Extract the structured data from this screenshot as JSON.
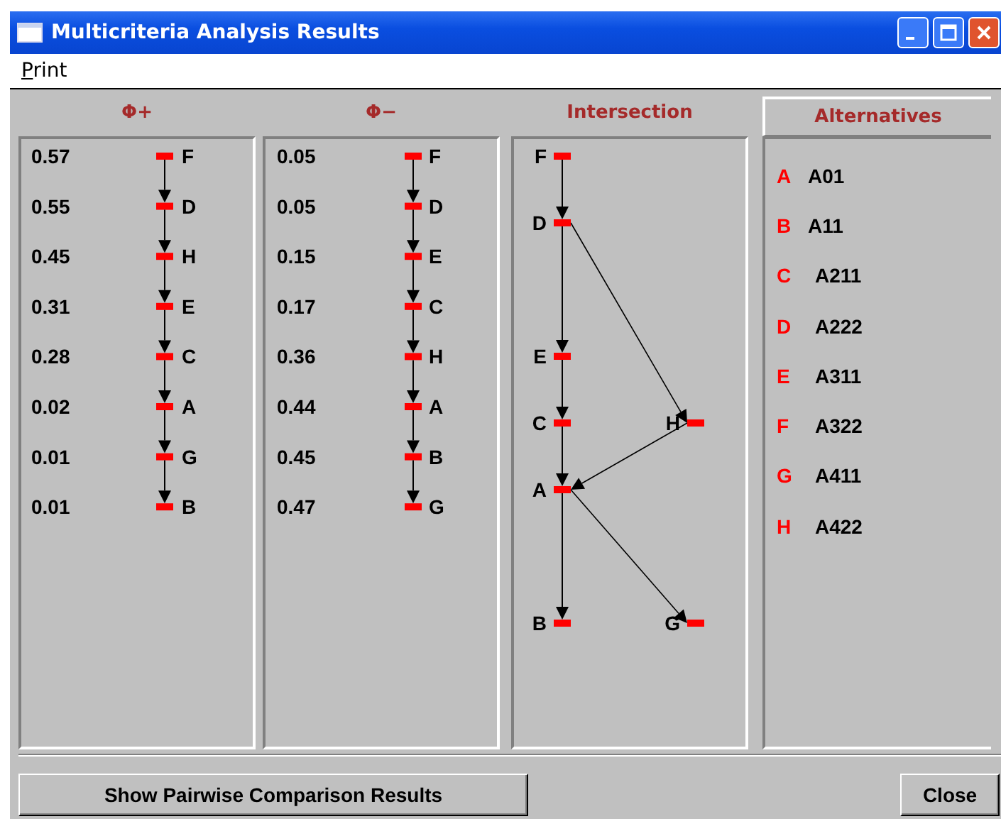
{
  "window": {
    "title": "Multicriteria Analysis Results"
  },
  "menu": [
    "Print"
  ],
  "rankings": [
    {
      "title": "Φ+",
      "rows": [
        {
          "value": "0.57",
          "node": "F"
        },
        {
          "value": "0.55",
          "node": "D"
        },
        {
          "value": "0.45",
          "node": "H"
        },
        {
          "value": "0.31",
          "node": "E"
        },
        {
          "value": "0.28",
          "node": "C"
        },
        {
          "value": "0.02",
          "node": "A"
        },
        {
          "value": "0.01",
          "node": "G"
        },
        {
          "value": "0.01",
          "node": "B"
        }
      ]
    },
    {
      "title": "Φ−",
      "rows": [
        {
          "value": "0.05",
          "node": "F"
        },
        {
          "value": "0.05",
          "node": "D"
        },
        {
          "value": "0.15",
          "node": "E"
        },
        {
          "value": "0.17",
          "node": "C"
        },
        {
          "value": "0.36",
          "node": "H"
        },
        {
          "value": "0.44",
          "node": "A"
        },
        {
          "value": "0.45",
          "node": "B"
        },
        {
          "value": "0.47",
          "node": "G"
        }
      ]
    }
  ],
  "intersection": {
    "title": "Intersection",
    "nodes": [
      "F",
      "D",
      "E",
      "C",
      "H",
      "A",
      "B",
      "G"
    ]
  },
  "alternatives": {
    "title": "Alternatives",
    "items": [
      {
        "code": "A",
        "name": "A01"
      },
      {
        "code": "B",
        "name": "A11"
      },
      {
        "code": "C",
        "name": "A211"
      },
      {
        "code": "D",
        "name": "A222"
      },
      {
        "code": "E",
        "name": "A311"
      },
      {
        "code": "F",
        "name": "A322"
      },
      {
        "code": "G",
        "name": "A411"
      },
      {
        "code": "H",
        "name": "A422"
      }
    ]
  },
  "buttons": [
    "Show Pairwise Comparison Results",
    "Close"
  ]
}
